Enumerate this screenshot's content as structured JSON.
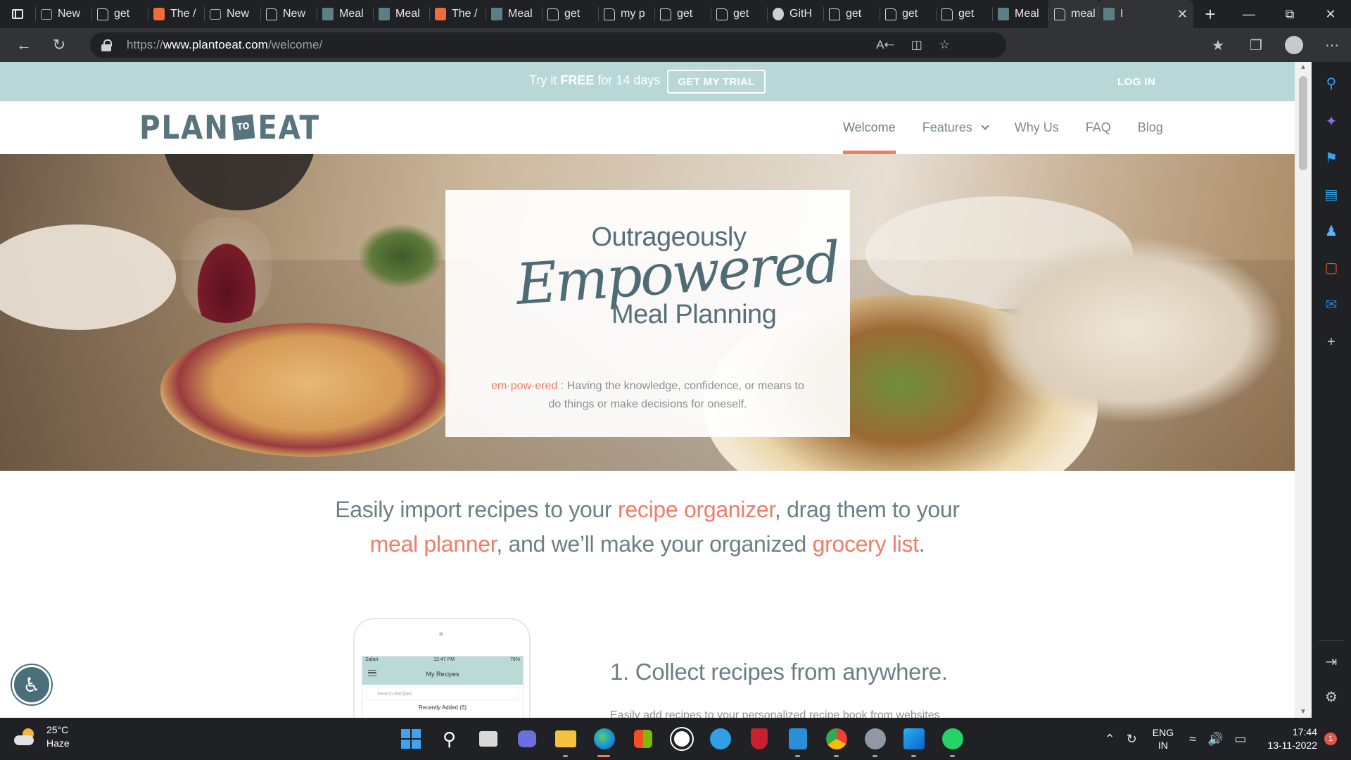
{
  "browser": {
    "tabs": [
      {
        "title": "New",
        "icon": "new-tab-icon"
      },
      {
        "title": "get",
        "icon": "document-icon"
      },
      {
        "title": "The /",
        "icon": "orange-app-icon"
      },
      {
        "title": "New",
        "icon": "new-tab-icon"
      },
      {
        "title": "New",
        "icon": "document-icon"
      },
      {
        "title": "Meal",
        "icon": "plantoeat-icon"
      },
      {
        "title": "Meal",
        "icon": "plantoeat-icon"
      },
      {
        "title": "The /",
        "icon": "orange-app-icon"
      },
      {
        "title": "Meal",
        "icon": "plantoeat-icon"
      },
      {
        "title": "get",
        "icon": "document-icon"
      },
      {
        "title": "my p",
        "icon": "document-icon"
      },
      {
        "title": "get",
        "icon": "document-icon"
      },
      {
        "title": "get",
        "icon": "document-icon"
      },
      {
        "title": "GitH",
        "icon": "github-icon"
      },
      {
        "title": "get",
        "icon": "document-icon"
      },
      {
        "title": "get",
        "icon": "document-icon"
      },
      {
        "title": "get",
        "icon": "document-icon"
      },
      {
        "title": "Meal",
        "icon": "plantoeat-icon"
      },
      {
        "title": "meal",
        "icon": "document-icon"
      },
      {
        "title": "I",
        "icon": "plantoeat-icon"
      }
    ],
    "url_prefix": "https://",
    "url_domain": "www.plantoeat.com",
    "url_path": "/welcome/"
  },
  "promo": {
    "try_prefix": "Try it ",
    "try_bold": "FREE",
    "try_suffix": " for 14 days",
    "trial_button": "GET MY TRIAL",
    "login": "LOG IN"
  },
  "header": {
    "logo_left": "PLAN",
    "logo_mid": "TO",
    "logo_right": "EAT",
    "nav": [
      {
        "label": "Welcome",
        "active": true
      },
      {
        "label": "Features",
        "dropdown": true
      },
      {
        "label": "Why Us"
      },
      {
        "label": "FAQ"
      },
      {
        "label": "Blog"
      }
    ]
  },
  "hero": {
    "line1": "Outrageously",
    "script": "Empowered",
    "line3": "Meal Planning",
    "term": "em·pow·ered",
    "definition": " : Having the knowledge, confidence, or means to do things or make decisions for oneself."
  },
  "intro": {
    "p1": "Easily import recipes to your ",
    "link1": "recipe organizer",
    "p2": ", drag them to your ",
    "link2": "meal planner",
    "p3": ", and we’ll make your organized ",
    "link3": "grocery list",
    "p4": "."
  },
  "phone": {
    "status_left": "Safari",
    "status_time": "12:47 PM",
    "status_right": "76%",
    "app_title": "My Recipes",
    "search_placeholder": "Search Recipes",
    "recent": "Recently Added (6)"
  },
  "step1": {
    "title": "1. Collect recipes from anywhere.",
    "desc": "Easily add recipes to your personalized recipe book from websites"
  },
  "taskbar": {
    "temp": "25°C",
    "condition": "Haze",
    "lang1": "ENG",
    "lang2": "IN",
    "time": "17:44",
    "date": "13-11-2022",
    "notifications": "1"
  },
  "colors": {
    "accent": "#ef7c68",
    "brand": "#58747c",
    "promo_bar": "#b7d8d6"
  }
}
